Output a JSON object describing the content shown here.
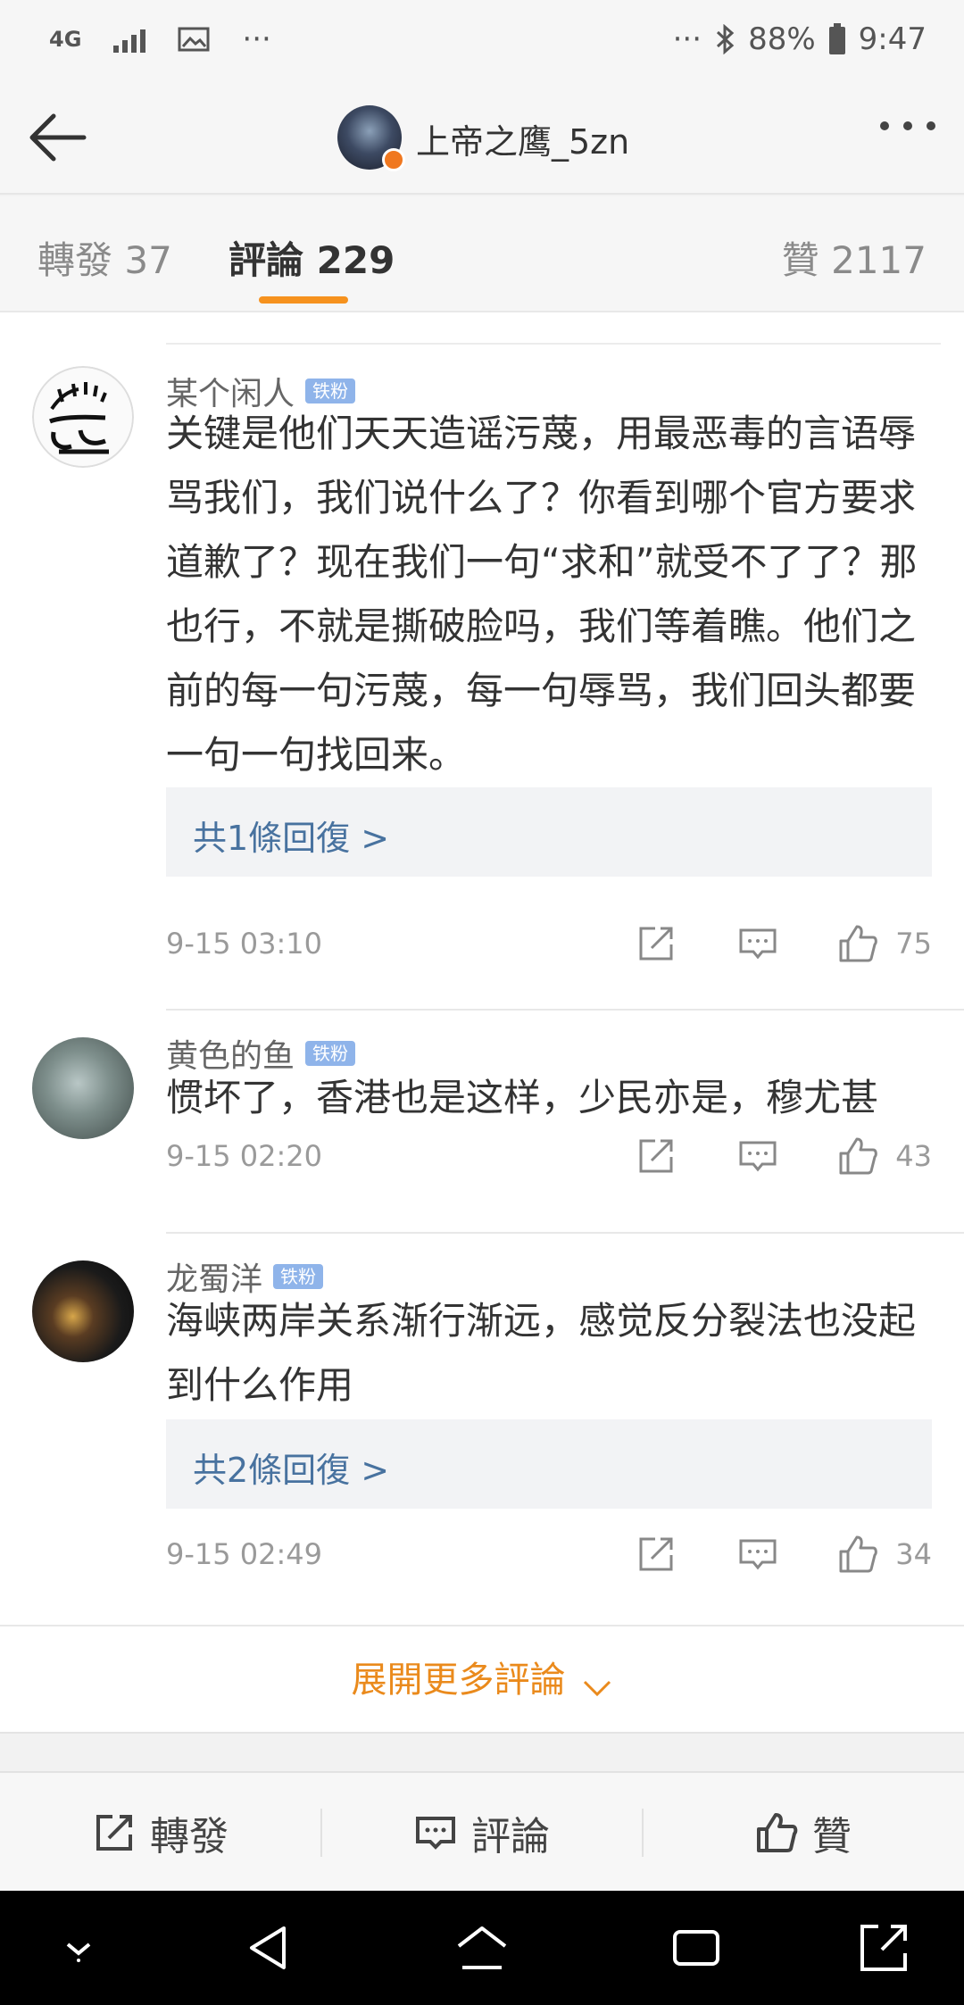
{
  "status_bar": {
    "network": "4G",
    "more_left": "···",
    "more_right": "···",
    "battery": "88%",
    "time": "9:47"
  },
  "header": {
    "username": "上帝之鹰_5zn"
  },
  "tabs": {
    "repost": "轉發 37",
    "comments": "評論 229",
    "likes": "贊 2117"
  },
  "comments": [
    {
      "name": "某个闲人",
      "tag": "铁粉",
      "text": "关键是他们天天造谣污蔑，用最恶毒的言语辱骂我们，我们说什么了？你看到哪个官方要求道歉了？现在我们一句“求和”就受不了了？那也行，不就是撕破脸吗，我们等着瞧。他们之前的每一句污蔑，每一句辱骂，我们回头都要一句一句找回来。",
      "replies": "共1條回復 >",
      "time": "9-15 03:10",
      "likes": "75"
    },
    {
      "name": "黄色的鱼",
      "tag": "铁粉",
      "text": "惯坏了，香港也是这样，少民亦是，穆尤甚",
      "time": "9-15 02:20",
      "likes": "43"
    },
    {
      "name": "龙蜀洋",
      "tag": "铁粉",
      "text": "海峡两岸关系渐行渐远，感觉反分裂法也没起到什么作用",
      "replies": "共2條回復 >",
      "time": "9-15 02:49",
      "likes": "34"
    }
  ],
  "expand_more": "展開更多評論",
  "action_bar": {
    "repost": "轉發",
    "comment": "評論",
    "like": "贊"
  },
  "colors": {
    "accent": "#f6921e",
    "link": "#48729f",
    "tag": "#8fb4ea"
  }
}
